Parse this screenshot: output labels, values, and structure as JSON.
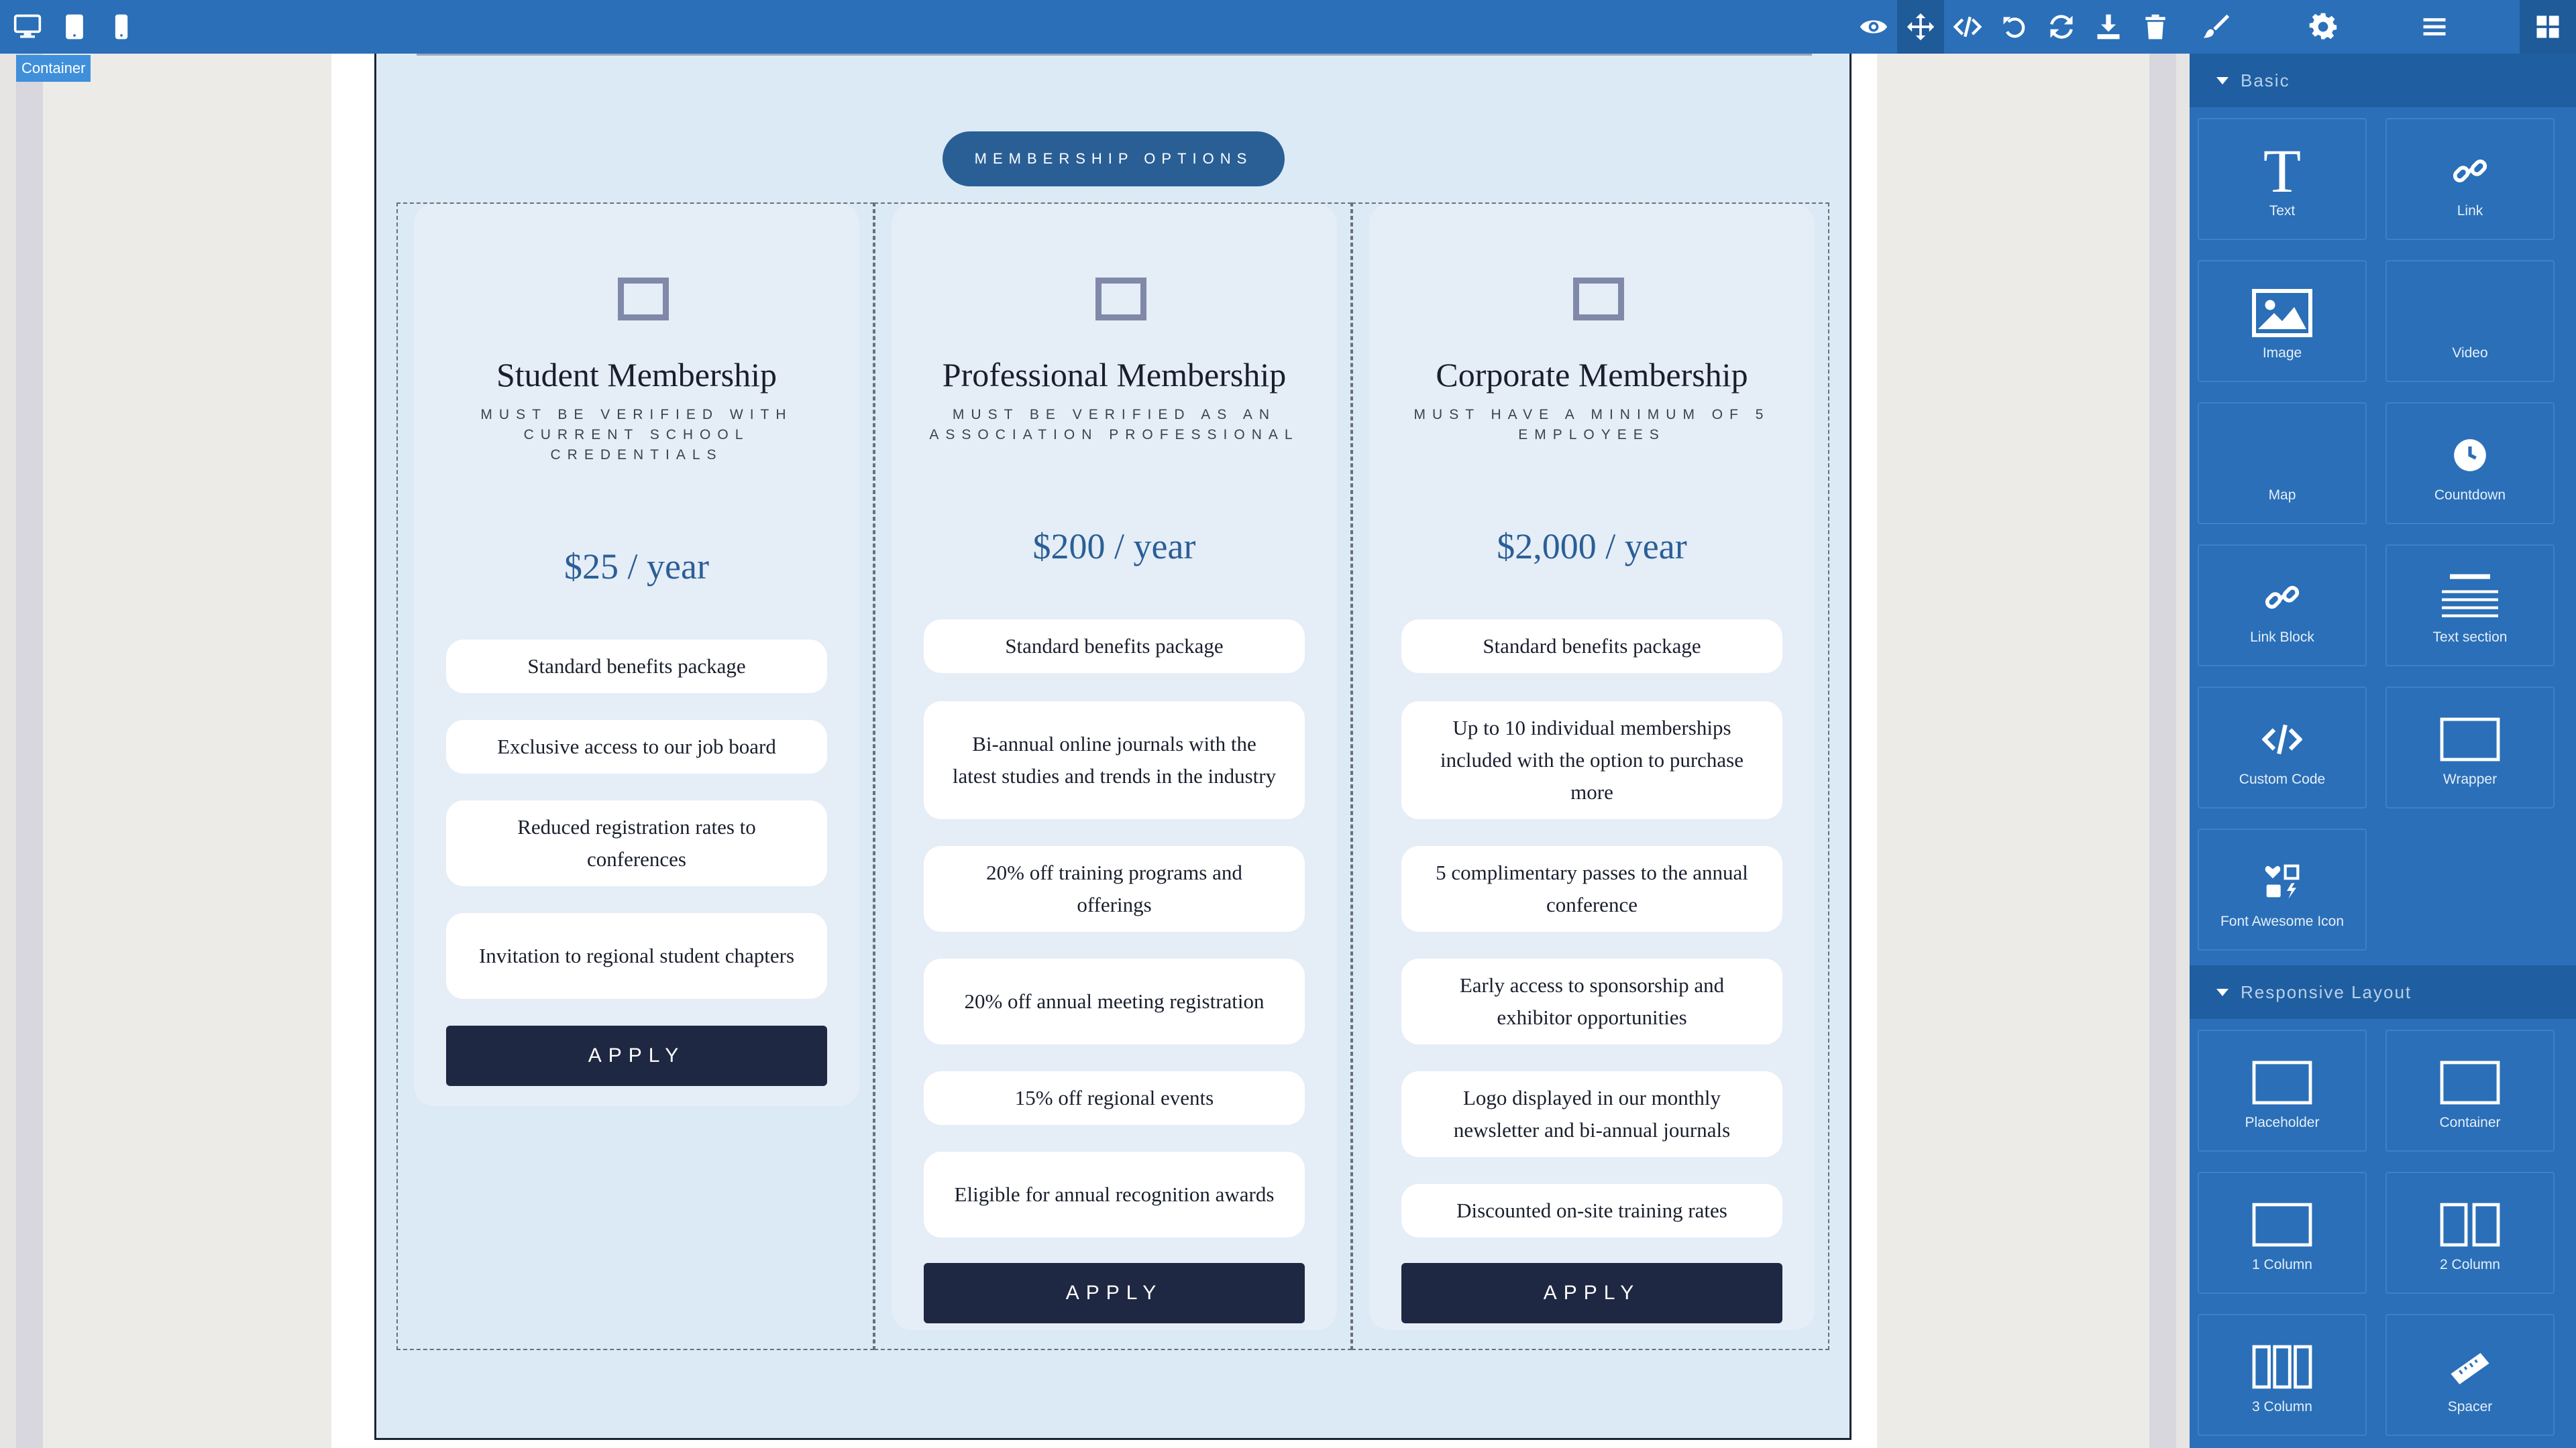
{
  "toolbar": {
    "device_buttons": [
      "desktop-icon",
      "tablet-icon",
      "mobile-icon"
    ],
    "action_buttons": [
      "eye-icon",
      "move-arrows-icon",
      "code-icon",
      "undo-icon",
      "redo-icon",
      "download-icon",
      "trash-icon"
    ],
    "panel_buttons": [
      "paintbrush-icon",
      "gear-icon",
      "hamburger-menu-icon",
      "blocks-grid-icon"
    ]
  },
  "canvas": {
    "selected_badge": "Container"
  },
  "section": {
    "label": "MEMBERSHIP OPTIONS",
    "cards": [
      {
        "title": "Student Membership",
        "subtitle": "MUST BE VERIFIED WITH CURRENT SCHOOL CREDENTIALS",
        "price": "$25 / year",
        "features": [
          "Standard benefits package",
          "Exclusive access to our job board",
          "Reduced registration rates to conferences",
          "Invitation to regional student chapters"
        ],
        "button": "APPLY"
      },
      {
        "title": "Professional Membership",
        "subtitle": "MUST BE VERIFIED AS AN ASSOCIATION PROFESSIONAL",
        "price": "$200 / year",
        "features": [
          "Standard benefits package",
          "Bi-annual online journals with the latest studies and trends in the industry",
          "20% off training programs and offerings",
          "20% off annual meeting registration",
          "15% off regional events",
          "Eligible for annual recognition awards"
        ],
        "button": "APPLY"
      },
      {
        "title": "Corporate Membership",
        "subtitle": "MUST HAVE A MINIMUM OF 5 EMPLOYEES",
        "price": "$2,000 / year",
        "features": [
          "Standard benefits package",
          "Up to 10 individual memberships included with the option to purchase more",
          "5 complimentary passes to the annual conference",
          "Early access to sponsorship and exhibitor opportunities",
          "Logo displayed in our monthly newsletter and bi-annual journals",
          "Discounted on-site training rates"
        ],
        "button": "APPLY"
      }
    ]
  },
  "panel": {
    "categories": [
      {
        "name": "Basic",
        "blocks": [
          {
            "label": "Text",
            "icon": "text-t-icon"
          },
          {
            "label": "Link",
            "icon": "link-icon"
          },
          {
            "label": "Image",
            "icon": "image-icon"
          },
          {
            "label": "Video",
            "icon": ""
          },
          {
            "label": "Map",
            "icon": ""
          },
          {
            "label": "Countdown",
            "icon": "clock-icon"
          },
          {
            "label": "Link Block",
            "icon": "link-icon"
          },
          {
            "label": "Text section",
            "icon": "text-lines-icon"
          },
          {
            "label": "Custom Code",
            "icon": "code-icon"
          },
          {
            "label": "Wrapper",
            "icon": "rectangle-icon"
          },
          {
            "label": "Font Awesome Icon",
            "icon": "font-awesome-icons-icon"
          }
        ]
      },
      {
        "name": "Responsive Layout",
        "blocks": [
          {
            "label": "Placeholder",
            "icon": "rectangle-icon"
          },
          {
            "label": "Container",
            "icon": "rectangle-icon"
          },
          {
            "label": "1 Column",
            "icon": "one-column-icon"
          },
          {
            "label": "2 Column",
            "icon": "two-column-icon"
          },
          {
            "label": "3 Column",
            "icon": "three-column-icon"
          },
          {
            "label": "Spacer",
            "icon": "ruler-icon"
          }
        ]
      }
    ]
  }
}
